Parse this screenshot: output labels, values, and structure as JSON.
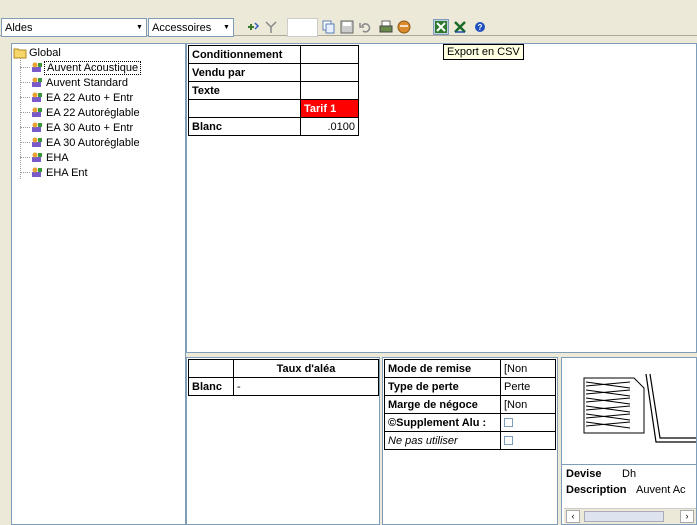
{
  "toolbar": {
    "combo1": "Aldes",
    "combo2": "Accessoires",
    "tooltip": "Export en CSV"
  },
  "tree": {
    "root": "Global",
    "items": [
      "Auvent Acoustique",
      "Auvent Standard",
      "EA 22 Auto + Entr",
      "EA 22 Autoréglable",
      "EA 30 Auto + Entr",
      "EA 30 Autoréglable",
      "EHA",
      "EHA Ent"
    ]
  },
  "grid": {
    "rows": [
      "Conditionnement",
      "Vendu par",
      "Texte"
    ],
    "tarif_header": "Tarif 1",
    "blanc_label": "Blanc",
    "blanc_value": ".0100"
  },
  "alea": {
    "header": "Taux d'aléa",
    "row_label": "Blanc",
    "row_value": "-"
  },
  "props": {
    "rows": [
      {
        "label": "Mode de remise",
        "value": "[Non"
      },
      {
        "label": "Type de perte",
        "value": "Perte"
      },
      {
        "label": "Marge de négoce",
        "value": "[Non"
      },
      {
        "label": "©Supplement Alu :",
        "value": ""
      },
      {
        "label": "Ne pas utiliser",
        "value": ""
      }
    ]
  },
  "info": {
    "devise_label": "Devise",
    "devise_value": "Dh",
    "desc_label": "Description",
    "desc_value": "Auvent Ac"
  }
}
